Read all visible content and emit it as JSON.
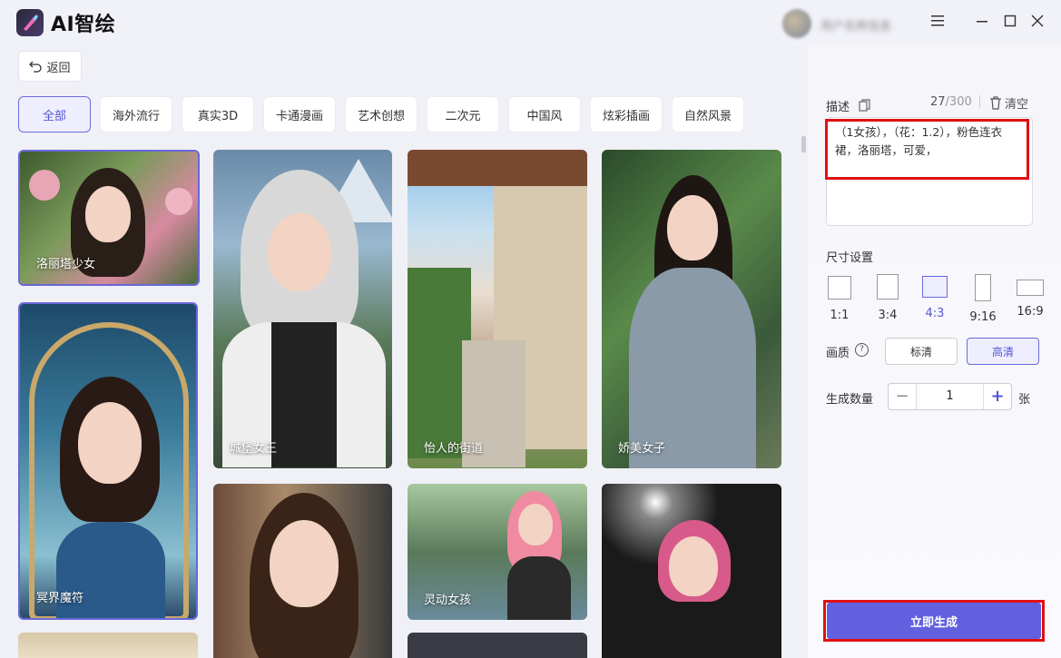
{
  "app": {
    "title": "AI智绘",
    "username": "用户名称信息"
  },
  "window": {
    "minimize": "—",
    "maximize": "☐",
    "close": "✕"
  },
  "toolbar": {
    "back_label": "返回"
  },
  "tabs": [
    {
      "label": "全部",
      "active": true
    },
    {
      "label": "海外流行"
    },
    {
      "label": "真实3D"
    },
    {
      "label": "卡通漫画"
    },
    {
      "label": "艺术创想"
    },
    {
      "label": "二次元"
    },
    {
      "label": "中国风"
    },
    {
      "label": "炫彩插画"
    },
    {
      "label": "自然风景"
    }
  ],
  "gallery": [
    {
      "label": "洛丽塔少女"
    },
    {
      "label": "冥界魔符"
    },
    {
      "label": "城堡女王"
    },
    {
      "label": "怡人的街道"
    },
    {
      "label": "娇美女子"
    },
    {
      "label": "灵动女孩"
    }
  ],
  "panel": {
    "desc_label": "描述",
    "counter_current": "27",
    "counter_max": "/300",
    "clear_label": "清空",
    "desc_text": "（1女孩），（花：1.2），粉色连衣裙，洛丽塔，可爱，",
    "size_label": "尺寸设置",
    "ratios": [
      "1:1",
      "3:4",
      "4:3",
      "9:16",
      "16:9"
    ],
    "selected_ratio": "4:3",
    "quality_label": "画质",
    "quality_help": "?",
    "quality_options": [
      "标清",
      "高清"
    ],
    "selected_quality": "高清",
    "count_label": "生成数量",
    "count_value": "1",
    "count_unit": "张",
    "minus": "−",
    "plus": "+",
    "generate_label": "立即生成"
  },
  "colors": {
    "accent": "#6161e0",
    "highlight": "#e01010"
  }
}
